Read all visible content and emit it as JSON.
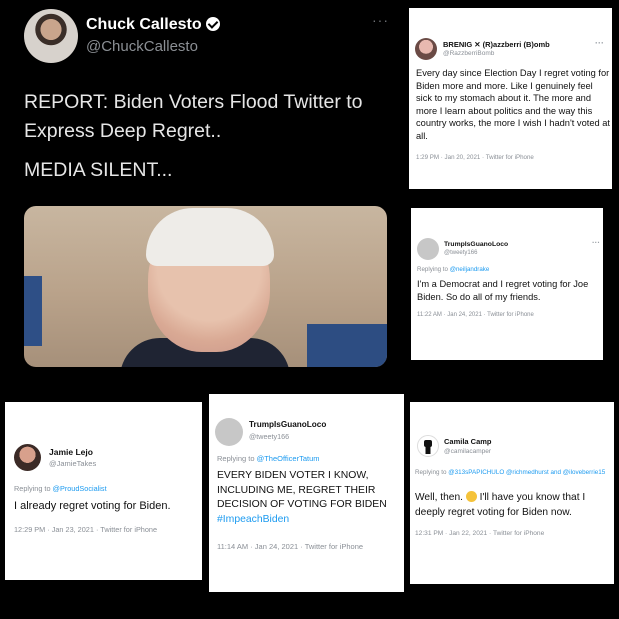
{
  "main_tweet": {
    "author_name": "Chuck Callesto",
    "handle": "@ChuckCallesto",
    "more": "···",
    "text_line": "REPORT: Biden Voters Flood Twitter to Express Deep Regret..",
    "text_line2": "MEDIA SILENT..."
  },
  "cards": {
    "brenig": {
      "author_name": "BRENIG ✕ (R)azzberri (B)omb",
      "handle": "@RazzberriBomb",
      "more": "···",
      "text": "Every day since Election Day I regret voting for Biden more and more. Like I genuinely feel sick to my stomach about it. The more and more I learn about politics and the way this country works, the more I wish I hadn't voted at all.",
      "meta": "1:29 PM · Jan 20, 2021 · Twitter for iPhone"
    },
    "tgl1": {
      "author_name": "TrumpIsGuanoLoco",
      "handle": "@tweety166",
      "more": "···",
      "reply_prefix": "Replying to ",
      "reply_to": "@neiljandrake",
      "text": "I'm a Democrat and I regret voting for Joe Biden. So do all of my friends.",
      "meta": "11:22 AM · Jan 24, 2021 · Twitter for iPhone"
    },
    "jamie": {
      "author_name": "Jamie Lejo",
      "handle": "@JamieTakes",
      "reply_prefix": "Replying to ",
      "reply_to": "@ProudSocialist",
      "text": "I already regret voting for Biden.",
      "meta": "12:29 PM · Jan 23, 2021 · Twitter for iPhone"
    },
    "tgl2": {
      "author_name": "TrumpIsGuanoLoco",
      "handle": "@tweety166",
      "reply_prefix": "Replying to ",
      "reply_to": "@TheOfficerTatum",
      "text": "EVERY BIDEN VOTER I KNOW, INCLUDING ME, REGRET THEIR DECISION OF VOTING FOR BIDEN",
      "hashtag": "#ImpeachBiden",
      "meta": "11:14 AM · Jan 24, 2021 · Twitter for iPhone"
    },
    "camila": {
      "author_name": "Camila Camp",
      "handle": "@camilacamper",
      "reply_prefix": "Replying to ",
      "reply_to": "@313sPAPICHULO @richmedhurst and @iloveberrie15",
      "text_before": "Well, then. ",
      "text_after": " I'll have you know that I deeply regret voting for Biden now.",
      "meta": "12:31 PM · Jan 22, 2021 · Twitter for iPhone"
    }
  },
  "icons": {
    "verified": "verified-badge-icon",
    "emoji": "unamused-face-emoji",
    "fist": "raised-fist-icon"
  },
  "colors": {
    "background": "#000000",
    "card": "#ffffff",
    "link": "#1d9bf0",
    "muted": "#8a8f96"
  }
}
